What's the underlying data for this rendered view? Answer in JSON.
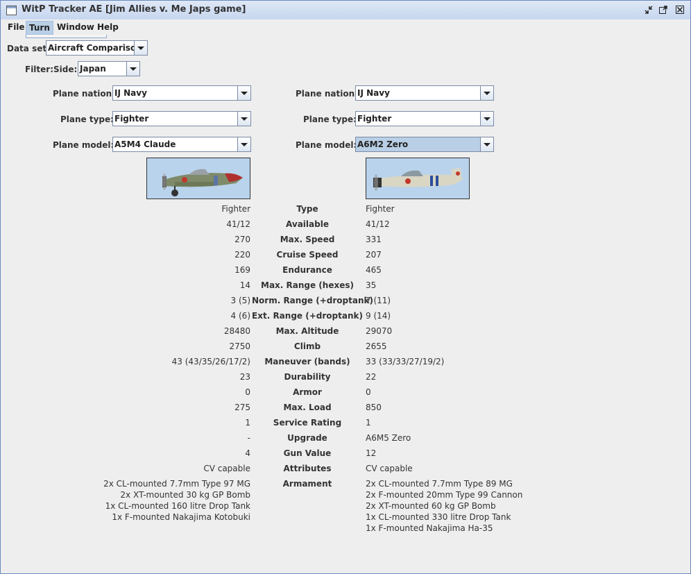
{
  "window": {
    "title": "WitP Tracker AE [Jim Allies v. Me Japs game]"
  },
  "menu": {
    "items": [
      "File",
      "Turn",
      "Window",
      "Help"
    ]
  },
  "dataset": {
    "label": "Data set:",
    "value": "Aircraft Comparison"
  },
  "filter": {
    "label": "Filter:",
    "side_label": "Side:",
    "side_value": "Japan"
  },
  "left": {
    "nation_label": "Plane nation:",
    "nation": "IJ Navy",
    "type_label": "Plane type:",
    "type": "Fighter",
    "model_label": "Plane model:",
    "model": "A5M4 Claude"
  },
  "right": {
    "nation_label": "Plane nation:",
    "nation": "IJ Navy",
    "type_label": "Plane type:",
    "type": "Fighter",
    "model_label": "Plane model:",
    "model": "A6M2 Zero"
  },
  "stats": [
    {
      "name": "Type",
      "left": "Fighter",
      "right": "Fighter"
    },
    {
      "name": "Available",
      "left": "41/12",
      "right": "41/12"
    },
    {
      "name": "Max. Speed",
      "left": "270",
      "right": "331"
    },
    {
      "name": "Cruise Speed",
      "left": "220",
      "right": "207"
    },
    {
      "name": "Endurance",
      "left": "169",
      "right": "465"
    },
    {
      "name": "Max. Range (hexes)",
      "left": "14",
      "right": "35"
    },
    {
      "name": "Norm. Range (+droptank)",
      "left": "3 (5)",
      "right": "7 (11)"
    },
    {
      "name": "Ext. Range (+droptank)",
      "left": "4 (6)",
      "right": "9 (14)"
    },
    {
      "name": "Max. Altitude",
      "left": "28480",
      "right": "29070"
    },
    {
      "name": "Climb",
      "left": "2750",
      "right": "2655"
    },
    {
      "name": "Maneuver (bands)",
      "left": "43 (43/35/26/17/2)",
      "right": "33 (33/33/27/19/2)"
    },
    {
      "name": "Durability",
      "left": "23",
      "right": "22"
    },
    {
      "name": "Armor",
      "left": "0",
      "right": "0"
    },
    {
      "name": "Max. Load",
      "left": "275",
      "right": "850"
    },
    {
      "name": "Service Rating",
      "left": "1",
      "right": "1"
    },
    {
      "name": "Upgrade",
      "left": "-",
      "right": "A6M5 Zero"
    },
    {
      "name": "Gun Value",
      "left": "4",
      "right": "12"
    },
    {
      "name": "Attributes",
      "left": "CV capable",
      "right": "CV capable"
    }
  ],
  "armament": {
    "name": "Armament",
    "left": [
      "2x CL-mounted 7.7mm Type 97 MG",
      "2x XT-mounted 30 kg GP Bomb",
      "1x CL-mounted 160 litre Drop Tank",
      "1x F-mounted Nakajima Kotobuki"
    ],
    "right": [
      "2x CL-mounted 7.7mm Type 89 MG",
      "2x F-mounted 20mm Type 99 Cannon",
      "2x XT-mounted 60 kg GP Bomb",
      "1x CL-mounted 330 litre Drop Tank",
      "1x F-mounted Nakajima Ha-35"
    ]
  }
}
